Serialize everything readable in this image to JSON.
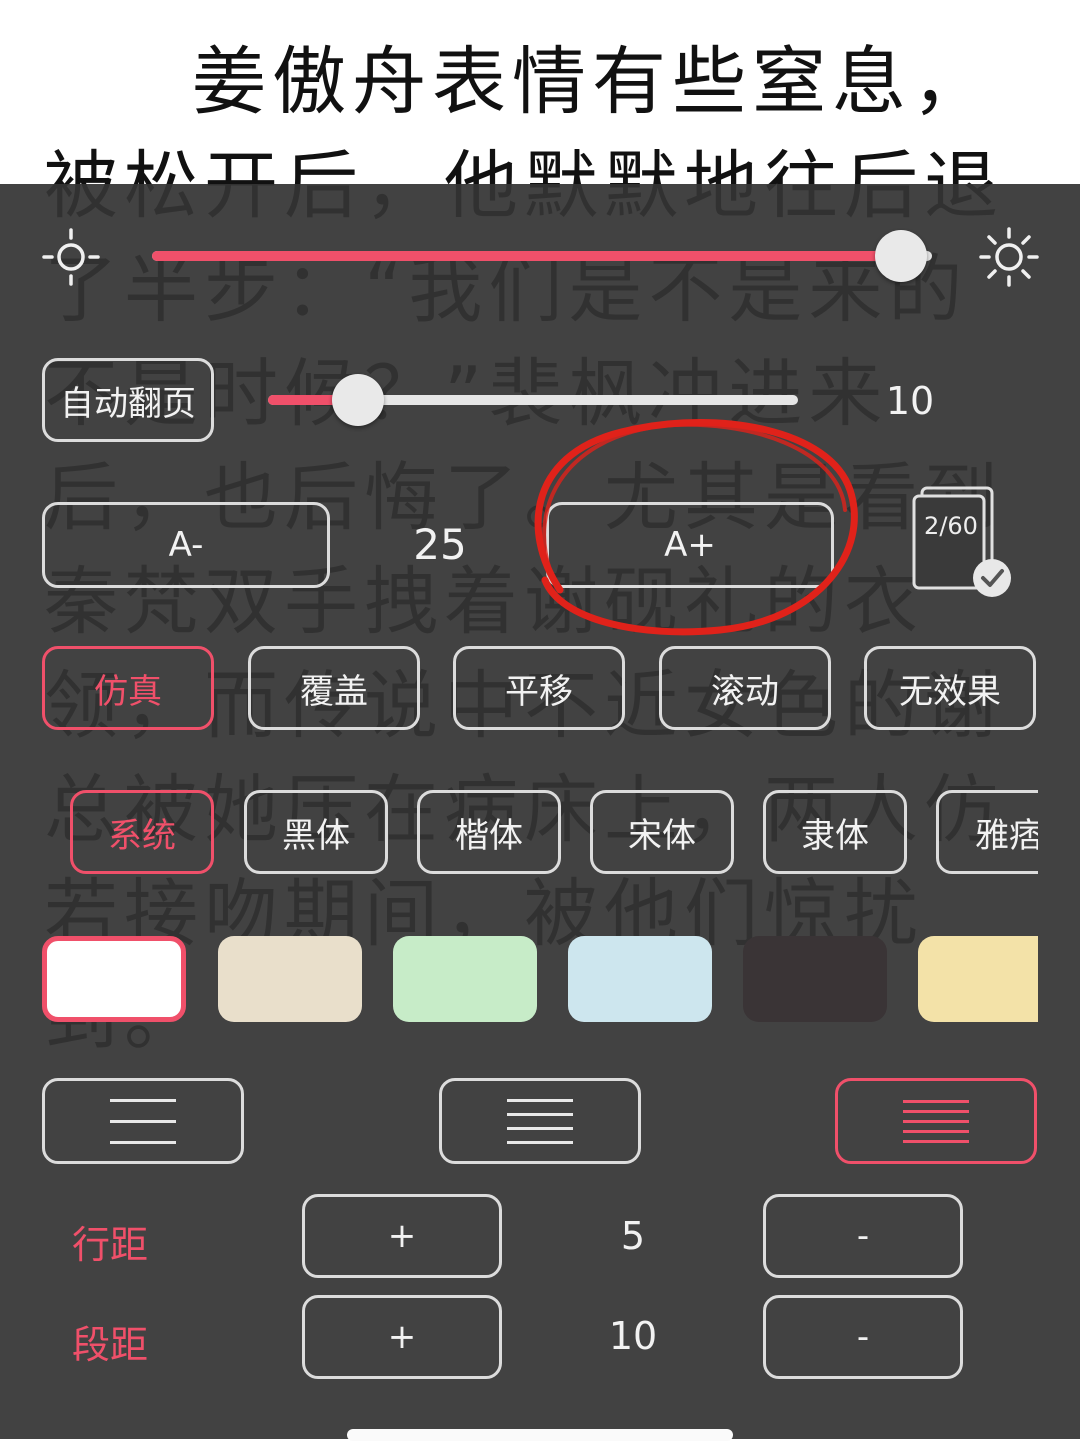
{
  "reader": {
    "paragraph": "姜傲舟表情有些窒息，被松开后，他默默地往后退了半步：“我们是不是来的不是时候？”裴枫冲进来后，也后悔了。尤其是看到秦梵双手拽着谢砚礼的衣领，而传说中不近女色的谢总被她压在病床上，两人仿若接吻期间，被他们惊扰到。"
  },
  "brightness": {
    "value": 0.96
  },
  "auto_page": {
    "label": "自动翻页",
    "speed": "10",
    "slider_fraction": 0.17
  },
  "font_size": {
    "decrease_label": "A-",
    "value": "25",
    "increase_label": "A+",
    "page_indicator": "2/60"
  },
  "page_effects": [
    {
      "label": "仿真",
      "active": true
    },
    {
      "label": "覆盖",
      "active": false
    },
    {
      "label": "平移",
      "active": false
    },
    {
      "label": "滚动",
      "active": false
    },
    {
      "label": "无效果",
      "active": false
    }
  ],
  "fonts": [
    {
      "label": "系统",
      "active": true
    },
    {
      "label": "黑体",
      "active": false
    },
    {
      "label": "楷体",
      "active": false
    },
    {
      "label": "宋体",
      "active": false
    },
    {
      "label": "隶体",
      "active": false
    },
    {
      "label": "雅痞",
      "active": false
    }
  ],
  "themes": [
    {
      "color": "#ffffff",
      "selected": true
    },
    {
      "color": "#e9dfcb",
      "selected": false
    },
    {
      "color": "#c7ecc8",
      "selected": false
    },
    {
      "color": "#cde6ee",
      "selected": false
    },
    {
      "color": "#3a3436",
      "selected": false
    },
    {
      "color": "#f3e2a8",
      "selected": false
    }
  ],
  "spacing_presets": [
    {
      "name": "loose",
      "active": false
    },
    {
      "name": "medium",
      "active": false
    },
    {
      "name": "tight",
      "active": true
    }
  ],
  "line_spacing": {
    "label": "行距",
    "plus": "+",
    "value": "5",
    "minus": "-"
  },
  "paragraph_spacing": {
    "label": "段距",
    "plus": "+",
    "value": "10",
    "minus": "-"
  },
  "colors": {
    "accent": "#f0506a",
    "annotation": "#e0221a"
  }
}
